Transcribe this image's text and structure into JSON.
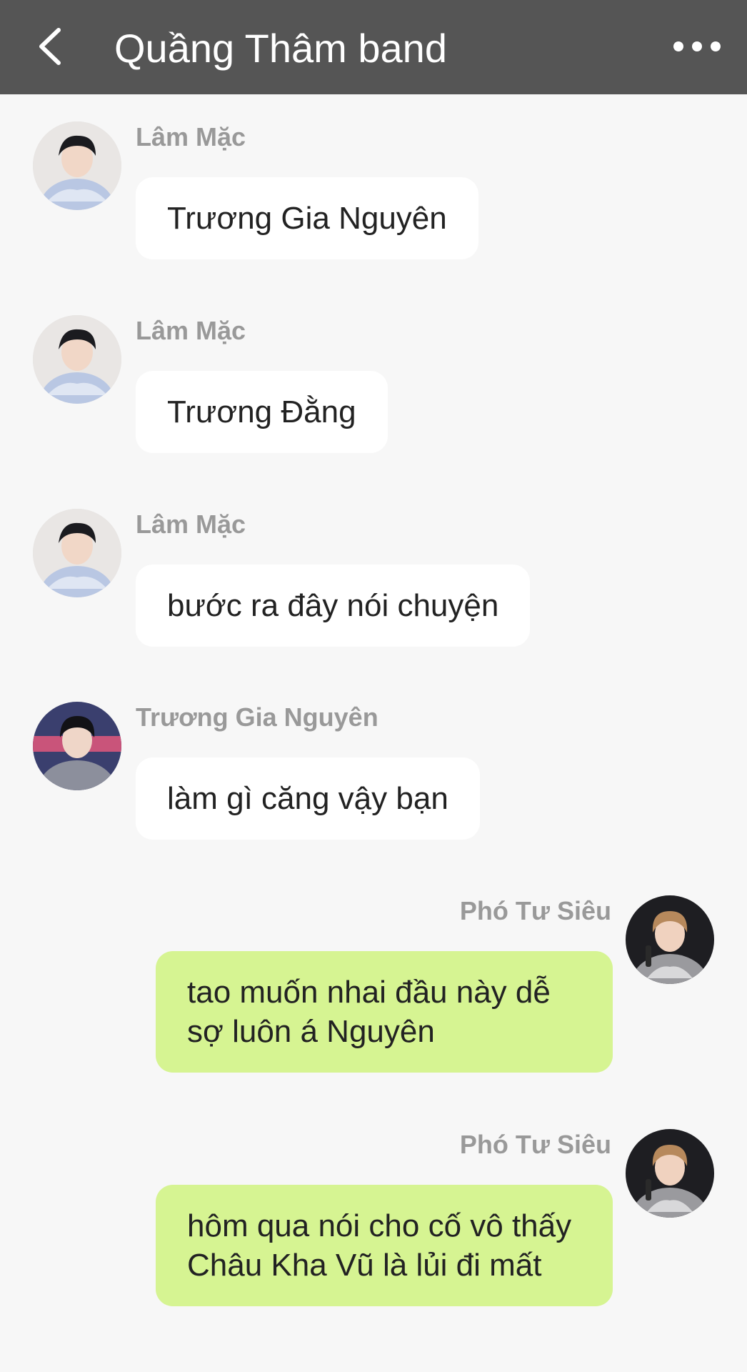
{
  "header": {
    "title": "Quầng Thâm band",
    "back_icon": "chevron-left-icon",
    "more_icon": "more-horizontal-icon"
  },
  "messages": [
    {
      "sender": "Lâm Mặc",
      "text": "Trương Gia Nguyên",
      "direction": "incoming",
      "avatar": "avatar-lam-mac"
    },
    {
      "sender": "Lâm Mặc",
      "text": "Trương Đằng",
      "direction": "incoming",
      "avatar": "avatar-lam-mac"
    },
    {
      "sender": "Lâm Mặc",
      "text": "bước ra đây nói chuyện",
      "direction": "incoming",
      "avatar": "avatar-lam-mac"
    },
    {
      "sender": "Trương Gia Nguyên",
      "text": "làm gì căng vậy bạn",
      "direction": "incoming",
      "avatar": "avatar-truong-gia-nguyen"
    },
    {
      "sender": "Phó Tư Siêu",
      "text": "tao muốn nhai đầu này dễ sợ luôn á Nguyên",
      "direction": "outgoing",
      "avatar": "avatar-pho-tu-sieu"
    },
    {
      "sender": "Phó Tư Siêu",
      "text": "hôm qua nói cho cố vô thấy Châu Kha Vũ là lủi đi mất",
      "direction": "outgoing",
      "avatar": "avatar-pho-tu-sieu"
    }
  ],
  "colors": {
    "header_bg": "#555555",
    "page_bg": "#f7f7f7",
    "incoming_bubble": "#ffffff",
    "outgoing_bubble": "#d6f492",
    "sender_text": "#999999"
  }
}
